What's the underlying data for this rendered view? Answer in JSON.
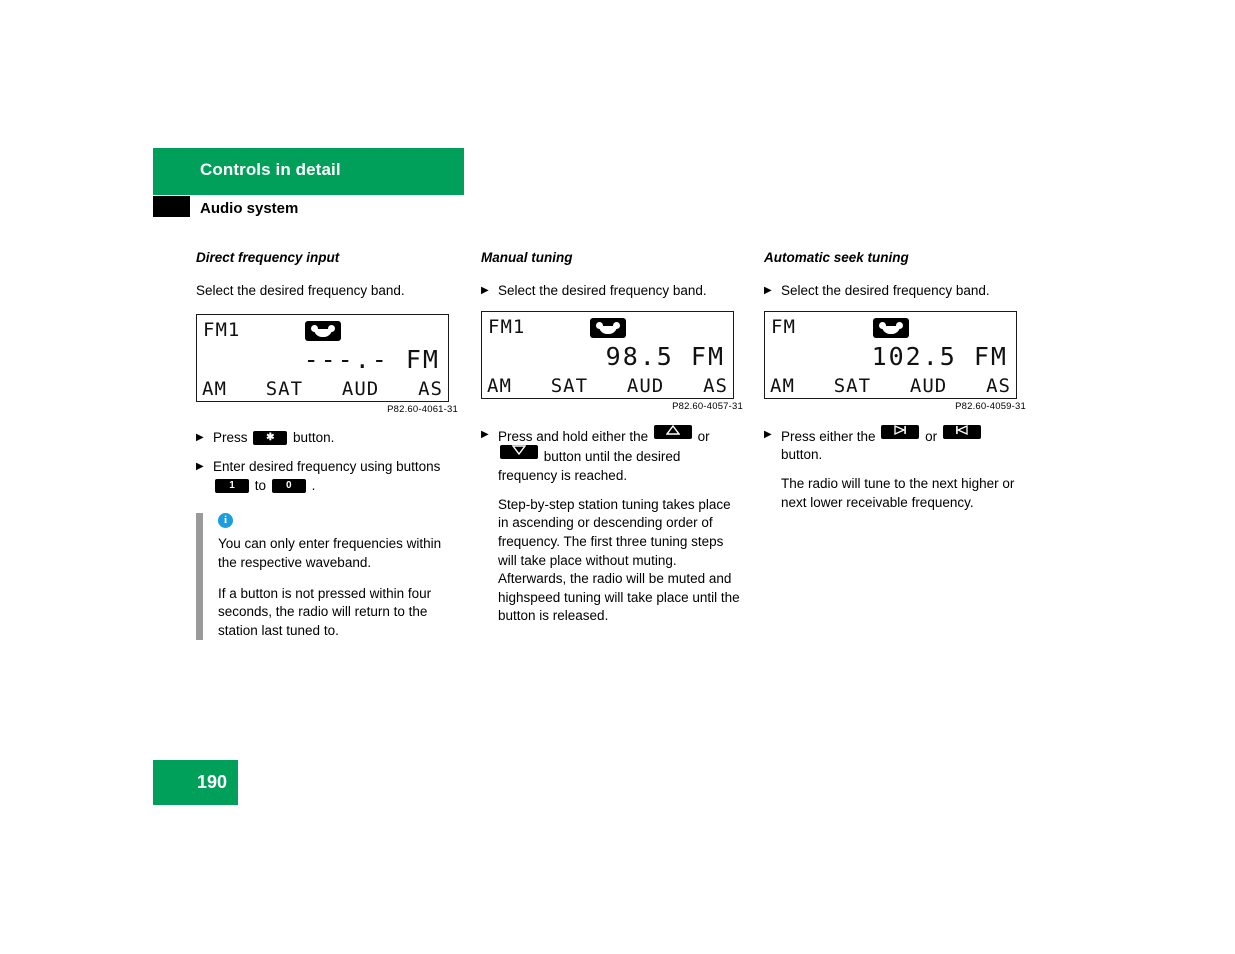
{
  "header": {
    "band_title": "Controls in detail",
    "section_title": "Audio system",
    "band_color": "#00a05a"
  },
  "columns": [
    {
      "title": "Direct frequency input",
      "intro": "Select the desired frequency band.",
      "display": {
        "band": "FM1",
        "media_icon": "cassette-icon",
        "frequency": "---.- FM",
        "softkeys": [
          "AM",
          "SAT",
          "AUD",
          "AS"
        ],
        "caption": "P82.60-4061-31"
      },
      "steps": [
        {
          "pre": "Press",
          "key": "star-key",
          "key_label": "✱",
          "post": "button."
        },
        {
          "pre": "Enter desired frequency using buttons",
          "key": "digit-key-1",
          "key_label": "1",
          "mid": "to",
          "key2": "digit-key-0",
          "key2_label": "0",
          "post": "."
        }
      ],
      "note": {
        "icon": "info-icon",
        "icon_glyph": "i",
        "paragraphs": [
          "You can only enter frequencies within the respective waveband.",
          "If a button is not pressed within four seconds, the radio will return to the station last tuned to."
        ]
      }
    },
    {
      "title": "Manual tuning",
      "intro": "Select the desired frequency band.",
      "display": {
        "band": "FM1",
        "media_icon": "cassette-icon",
        "frequency": "98.5 FM",
        "softkeys": [
          "AM",
          "SAT",
          "AUD",
          "AS"
        ],
        "caption": "P82.60-4057-31"
      },
      "steps": [
        {
          "pre": "Press and hold either the",
          "key": "tune-up-key",
          "mid": "or",
          "key2": "tune-down-key",
          "post": "button until the desired frequency is reached."
        }
      ],
      "paragraph": "Step-by-step station tuning takes place in ascending or descending order of frequency. The first three tuning steps will take place without muting. Afterwards, the radio will be muted and highspeed tuning will take place until the button is released."
    },
    {
      "title": "Automatic seek tuning",
      "intro": "Select the desired frequency band.",
      "display": {
        "band": "FM",
        "media_icon": "cassette-icon",
        "frequency": "102.5 FM",
        "softkeys": [
          "AM",
          "SAT",
          "AUD",
          "AS"
        ],
        "caption": "P82.60-4059-31"
      },
      "steps": [
        {
          "pre": "Press either the",
          "key": "seek-forward-key",
          "mid": "or",
          "key2": "seek-back-key",
          "post": "button."
        }
      ],
      "paragraph": "The radio will tune to the next higher or next lower receivable frequency."
    }
  ],
  "footer": {
    "page_number": "190"
  }
}
